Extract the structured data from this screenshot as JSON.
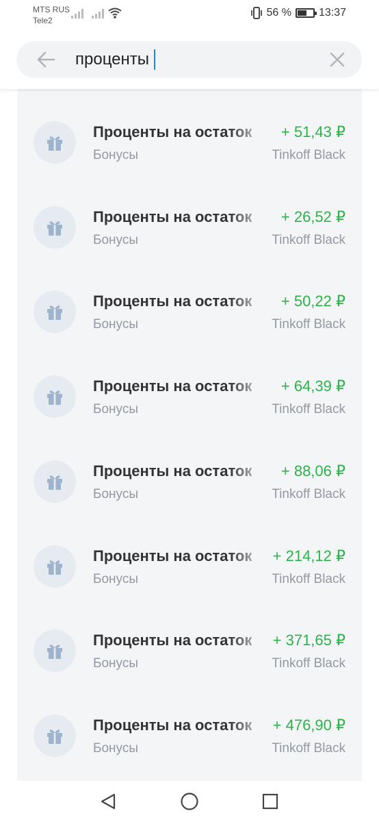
{
  "status_bar": {
    "carrier_1": "MTS RUS",
    "carrier_2": "Tele2",
    "battery": "56 %",
    "time": "13:37"
  },
  "search": {
    "query": "проценты",
    "back_icon": "arrow-left-icon",
    "clear_icon": "close-icon"
  },
  "colors": {
    "amount": "#2bb34a",
    "icon_bg": "#e6ebf2",
    "icon_fg": "#9db4cc",
    "list_bg": "#f4f5f7"
  },
  "transactions": [
    {
      "title": "Проценты на остаток",
      "category": "Бонусы",
      "amount": "+ 51,43 ₽",
      "account": "Tinkoff Black",
      "icon": "gift-icon"
    },
    {
      "title": "Проценты на остаток",
      "category": "Бонусы",
      "amount": "+ 26,52 ₽",
      "account": "Tinkoff Black",
      "icon": "gift-icon"
    },
    {
      "title": "Проценты на остаток",
      "category": "Бонусы",
      "amount": "+ 50,22 ₽",
      "account": "Tinkoff Black",
      "icon": "gift-icon"
    },
    {
      "title": "Проценты на остаток",
      "category": "Бонусы",
      "amount": "+ 64,39 ₽",
      "account": "Tinkoff Black",
      "icon": "gift-icon"
    },
    {
      "title": "Проценты на остаток",
      "category": "Бонусы",
      "amount": "+ 88,06 ₽",
      "account": "Tinkoff Black",
      "icon": "gift-icon"
    },
    {
      "title": "Проценты на остаток",
      "category": "Бонусы",
      "amount": "+ 214,12 ₽",
      "account": "Tinkoff Black",
      "icon": "gift-icon"
    },
    {
      "title": "Проценты на остаток",
      "category": "Бонусы",
      "amount": "+ 371,65 ₽",
      "account": "Tinkoff Black",
      "icon": "gift-icon"
    },
    {
      "title": "Проценты на остаток",
      "category": "Бонусы",
      "amount": "+ 476,90 ₽",
      "account": "Tinkoff Black",
      "icon": "gift-icon"
    }
  ],
  "nav": {
    "back_icon": "nav-back-icon",
    "home_icon": "nav-home-icon",
    "recents_icon": "nav-recents-icon"
  }
}
